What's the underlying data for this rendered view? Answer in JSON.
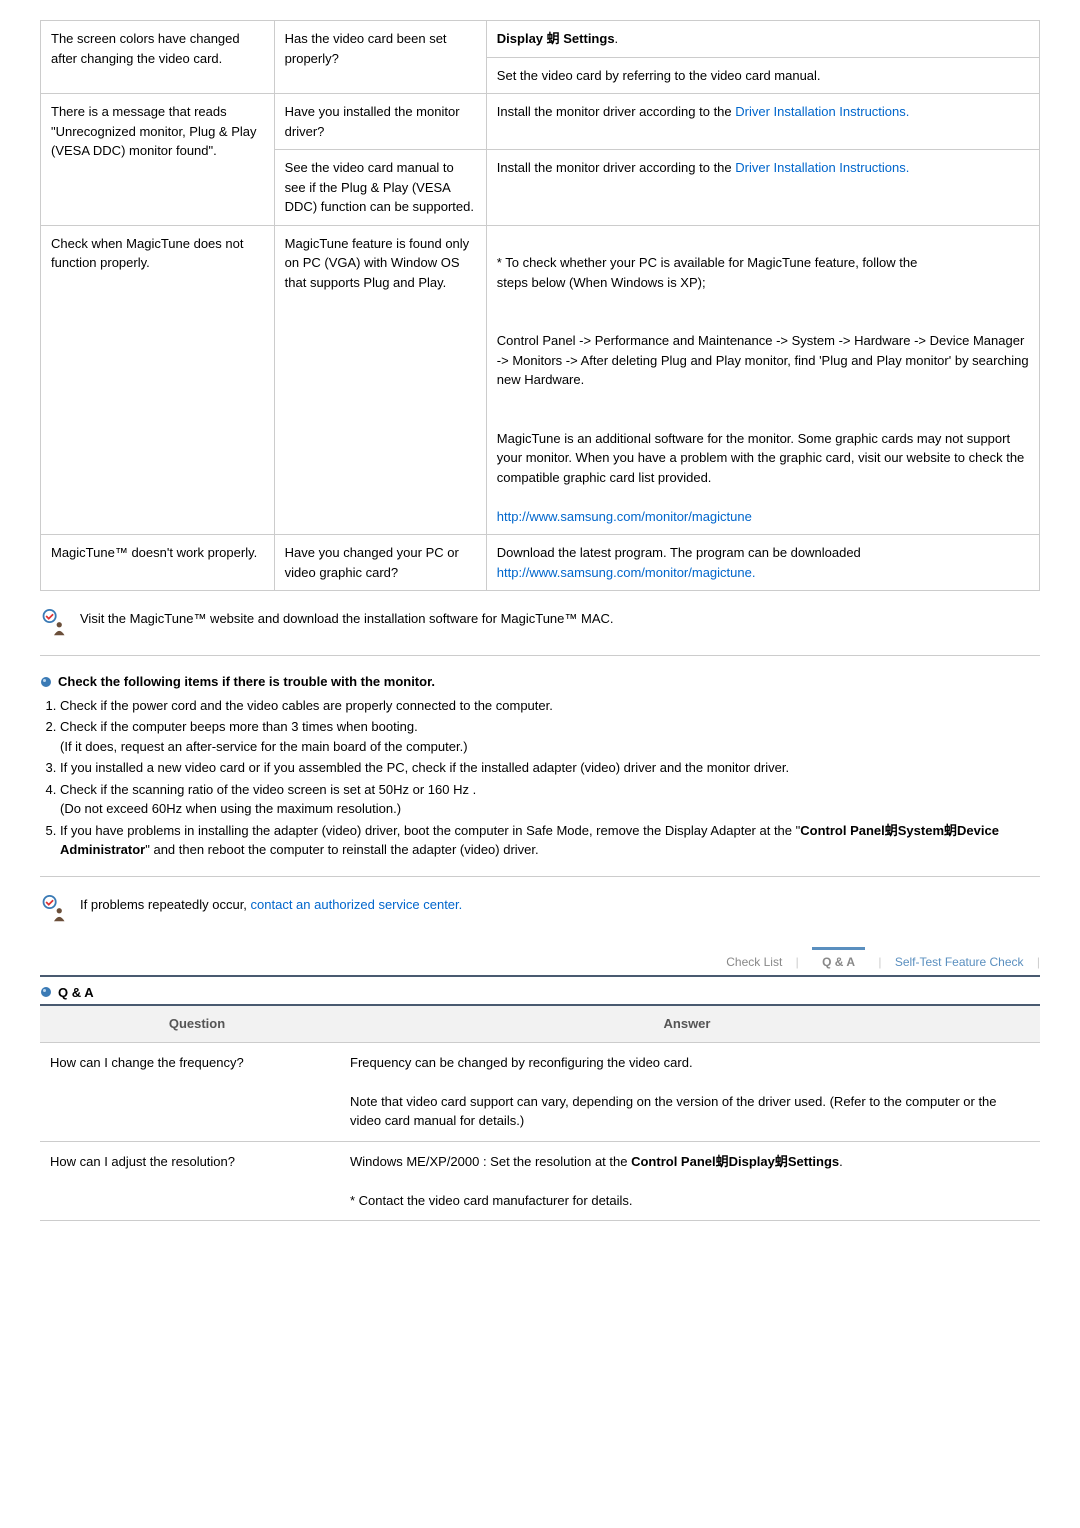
{
  "trouble": {
    "rows": [
      {
        "c1": "The screen colors have changed after changing the video card.",
        "c2": "Has the video card been set properly?",
        "c3_pre": "Display 蚏 Settings",
        "c3_pre_bold": true,
        "c3_post": ".",
        "c3_extra": "Set the video card by referring to the video card manual."
      },
      {
        "c1": "There is a message that reads \"Unrecognized monitor, Plug & Play (VESA DDC) monitor found\".",
        "sub": [
          {
            "c2": "Have you installed the monitor driver?",
            "c3": "Install the monitor driver according to the ",
            "c3_link": "Driver Installation Instructions."
          },
          {
            "c2": "See the video card manual to see if the Plug & Play (VESA DDC) function can be supported.",
            "c3": "Install the monitor driver according to the ",
            "c3_link": "Driver Installation Instructions."
          }
        ]
      },
      {
        "c1": "Check when MagicTune does not function properly.",
        "c2": "MagicTune feature is found only on PC (VGA) with Window OS that supports Plug and Play.",
        "c3_parts": [
          "* To check whether your PC is available for MagicTune feature, follow the\n  steps below (When Windows is XP);",
          "",
          "Control Panel -> Performance and Maintenance -> System -> Hardware -> Device Manager -> Monitors -> After deleting Plug and Play monitor, find 'Plug and Play monitor' by searching new Hardware.",
          "",
          "MagicTune is an additional software for the monitor. Some graphic cards may not support your monitor. When you have a problem with the graphic card, visit our website to check the compatible graphic card list provided."
        ],
        "c3_tail_link": "http://www.samsung.com/monitor/magictune"
      },
      {
        "c1": "MagicTune™ doesn't work properly.",
        "c2": "Have you changed your PC or video graphic card?",
        "c3": "Download the latest program. The program can be downloaded",
        "c3_link": "http://www.samsung.com/monitor/magictune."
      }
    ]
  },
  "note1": "Visit the MagicTune™ website and download the installation software for MagicTune™ MAC.",
  "check_title": "Check the following items if there is trouble with the monitor.",
  "check_items": [
    "Check if the power cord and the video cables are properly connected to the computer.",
    "Check if the computer beeps more than 3 times when booting.\n(If it does, request an after-service for the main board of the computer.)",
    "If you installed a new video card or if you assembled the PC, check if the installed adapter (video) driver and the monitor driver.",
    "Check if the scanning ratio of the video screen is set at 50Hz or 160 Hz .\n(Do not exceed 60Hz when using the maximum resolution.)",
    "If you have problems in installing the adapter (video) driver, boot the computer in Safe Mode, remove the Display Adapter at the \"Control Panel蚏System蚏Device Administrator\" and then reboot the computer to reinstall the adapter (video) driver."
  ],
  "check_item5_bold": "Control Panel蚏System蚏Device Administrator",
  "note2_pre": "If problems repeatedly occur, ",
  "note2_link": "contact an authorized service center.",
  "tabs": {
    "check": "Check List",
    "qa": "Q & A",
    "self": "Self-Test Feature Check"
  },
  "qa_title": "Q & A",
  "qa_header": {
    "q": "Question",
    "a": "Answer"
  },
  "qa_rows": [
    {
      "q": "How can I change the frequency?",
      "a": "Frequency can be changed by reconfiguring the video card.\n\nNote that video card support can vary, depending on the version of the driver used. (Refer to the computer or the video card manual for details.)"
    },
    {
      "q": "How can I adjust the resolution?",
      "a_pre": "Windows ME/XP/2000 : Set the resolution at the ",
      "a_bold": "Control Panel蚏Display蚏Settings",
      "a_post": ".\n\n* Contact the video card manufacturer for details."
    }
  ]
}
